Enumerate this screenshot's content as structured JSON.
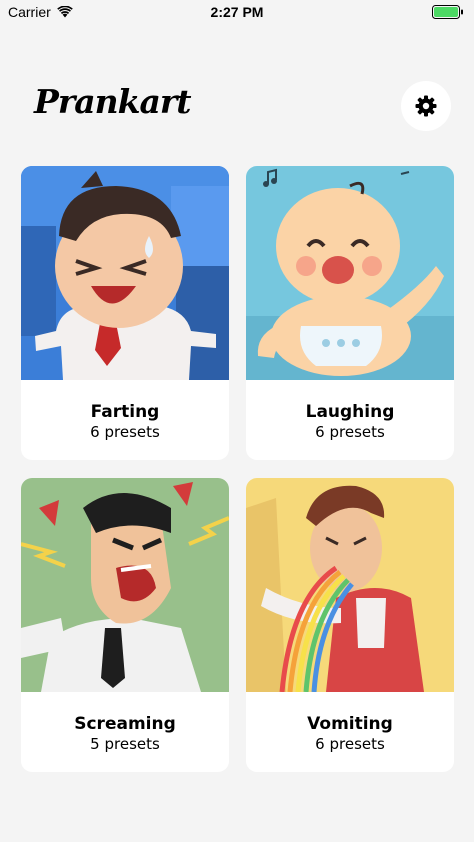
{
  "status_bar": {
    "carrier": "Carrier",
    "time": "2:27 PM"
  },
  "app": {
    "title": "Prankart"
  },
  "categories": [
    {
      "title": "Farting",
      "subtitle": "6 presets"
    },
    {
      "title": "Laughing",
      "subtitle": "6 presets"
    },
    {
      "title": "Screaming",
      "subtitle": "5 presets"
    },
    {
      "title": "Vomiting",
      "subtitle": "6 presets"
    }
  ],
  "colors": {
    "background": "#f4f4f4",
    "card": "#ffffff",
    "farting_bg": "#3b7ed8",
    "laughing_bg": "#76c7de",
    "screaming_bg": "#98c08b",
    "vomiting_bg": "#f6d97a",
    "battery": "#4cd964"
  },
  "icons": [
    "wifi-icon",
    "battery-icon",
    "gear-icon"
  ]
}
